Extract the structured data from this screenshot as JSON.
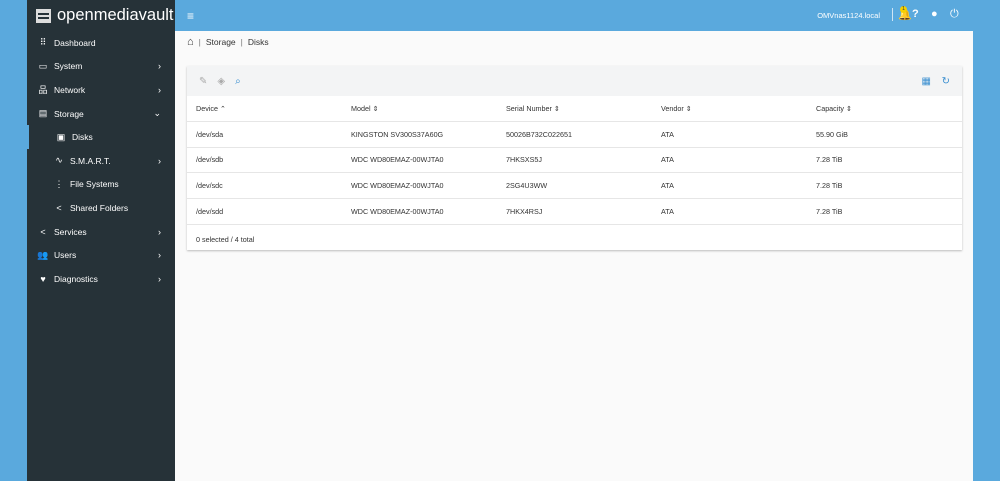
{
  "app": {
    "title": "openmediavault",
    "hostname": "OMVnas1124.local",
    "notification_count": "1"
  },
  "sidebar": {
    "items": [
      {
        "label": "Dashboard",
        "icon": "grid-icon",
        "glyph": "⠿",
        "chev": ""
      },
      {
        "label": "System",
        "icon": "laptop-icon",
        "glyph": "▭",
        "chev": "›"
      },
      {
        "label": "Network",
        "icon": "network-icon",
        "glyph": "品",
        "chev": "›"
      },
      {
        "label": "Storage",
        "icon": "storage-icon",
        "glyph": "▤",
        "chev": "⌄"
      },
      {
        "label": "Disks",
        "icon": "disk-icon",
        "glyph": "▣",
        "chev": ""
      },
      {
        "label": "S.M.A.R.T.",
        "icon": "pulse-icon",
        "glyph": "∿",
        "chev": "›"
      },
      {
        "label": "File Systems",
        "icon": "tree-icon",
        "glyph": "⋮",
        "chev": ""
      },
      {
        "label": "Shared Folders",
        "icon": "share-icon",
        "glyph": "<",
        "chev": ""
      },
      {
        "label": "Services",
        "icon": "share-icon",
        "glyph": "<",
        "chev": "›"
      },
      {
        "label": "Users",
        "icon": "users-icon",
        "glyph": "👥",
        "chev": "›"
      },
      {
        "label": "Diagnostics",
        "icon": "heart-pulse-icon",
        "glyph": "♥",
        "chev": "›"
      }
    ]
  },
  "breadcrumb": [
    "Storage",
    "Disks"
  ],
  "table": {
    "columns": [
      "Device ⌃",
      "Model ⇕",
      "Serial Number ⇕",
      "Vendor ⇕",
      "Capacity ⇕"
    ],
    "rows": [
      [
        "/dev/sda",
        "KINGSTON SV300S37A60G",
        "50026B732C022651",
        "ATA",
        "55.90 GiB"
      ],
      [
        "/dev/sdb",
        "WDC WD80EMAZ-00WJTA0",
        "7HKSXS5J",
        "ATA",
        "7.28 TiB"
      ],
      [
        "/dev/sdc",
        "WDC WD80EMAZ-00WJTA0",
        "2SG4U3WW",
        "ATA",
        "7.28 TiB"
      ],
      [
        "/dev/sdd",
        "WDC WD80EMAZ-00WJTA0",
        "7HKX4RSJ",
        "ATA",
        "7.28 TiB"
      ]
    ],
    "footer": "0 selected / 4 total"
  }
}
